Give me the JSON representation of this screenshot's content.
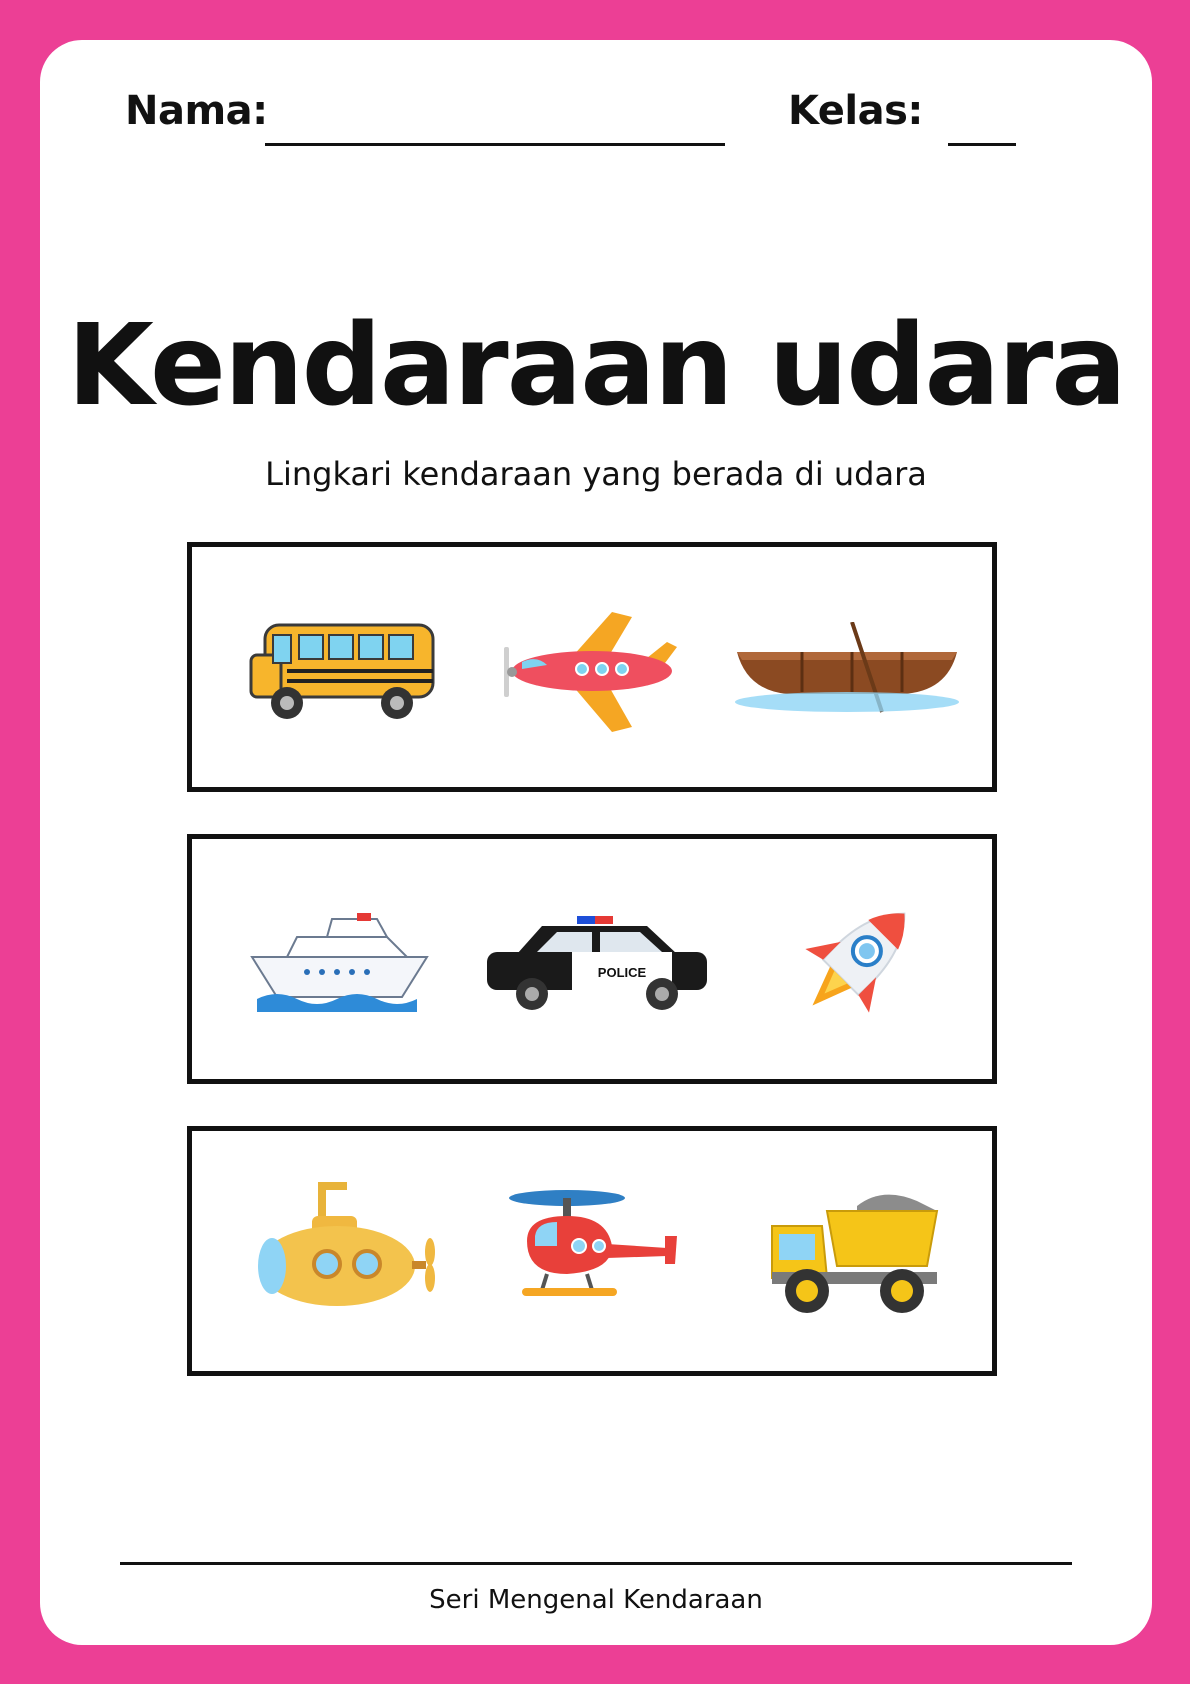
{
  "header": {
    "name_label": "Nama:",
    "class_label": "Kelas:"
  },
  "title": "Kendaraan udara",
  "subtitle": "Lingkari kendaraan yang berada di udara",
  "rows": [
    {
      "vehicles": [
        "bus-icon",
        "airplane-icon",
        "rowboat-icon"
      ]
    },
    {
      "vehicles": [
        "ship-icon",
        "police-car-icon",
        "rocket-icon"
      ]
    },
    {
      "vehicles": [
        "submarine-icon",
        "helicopter-icon",
        "dump-truck-icon"
      ]
    }
  ],
  "police_car_label": "POLICE",
  "footer": "Seri Mengenal Kendaraan",
  "colors": {
    "border": "#EC3F95",
    "page": "#FFFFFF",
    "ink": "#111111"
  }
}
